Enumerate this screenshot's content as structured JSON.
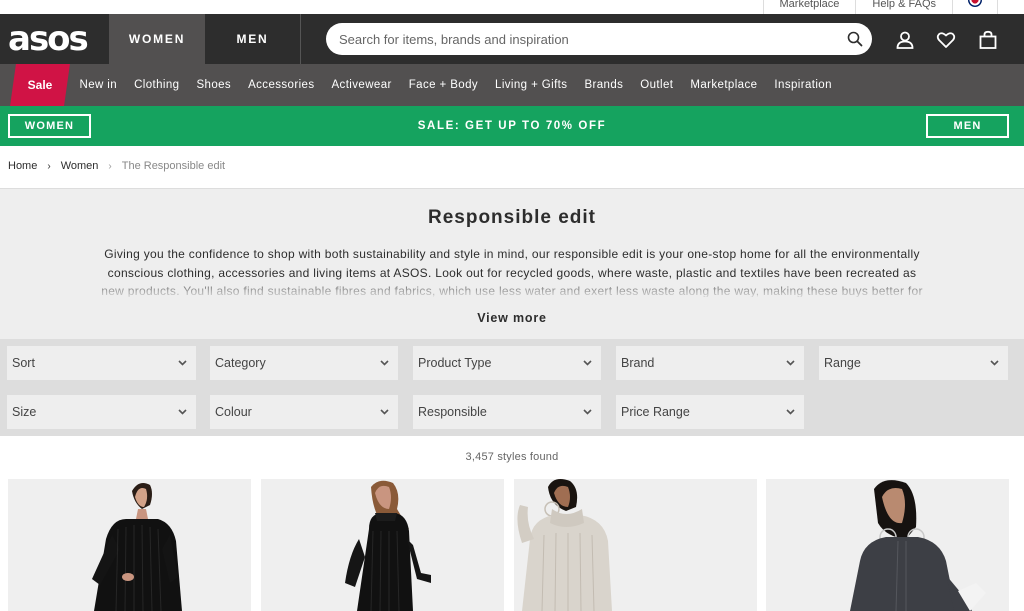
{
  "utility": {
    "links": [
      "Marketplace",
      "Help & FAQs"
    ],
    "flag": "uk-flag-icon"
  },
  "header": {
    "logo": "asos",
    "gender_tabs": [
      "WOMEN",
      "MEN"
    ],
    "search_placeholder": "Search for items, brands and inspiration",
    "icons": [
      "search-icon",
      "account-icon",
      "heart-icon",
      "bag-icon"
    ]
  },
  "catnav": {
    "sale": "Sale",
    "items": [
      "New in",
      "Clothing",
      "Shoes",
      "Accessories",
      "Activewear",
      "Face + Body",
      "Living + Gifts",
      "Brands",
      "Outlet",
      "Marketplace",
      "Inspiration"
    ]
  },
  "promo": {
    "left_button": "WOMEN",
    "text": "SALE: GET UP TO 70% OFF",
    "right_button": "MEN"
  },
  "breadcrumb": {
    "items": [
      "Home",
      "Women",
      "The Responsible edit"
    ]
  },
  "intro": {
    "title": "Responsible edit",
    "description": "Giving you the confidence to shop with both sustainability and style in mind, our responsible edit is your one-stop home for all the environmentally conscious clothing, accessories and living items at ASOS. Look out for recycled goods, where waste, plastic and textiles have been recreated as new products. You'll also find sustainable fibres and fabrics, which use less water and exert less waste along the way, making these buys better for the",
    "view_more": "View more"
  },
  "filters": {
    "row1": [
      "Sort",
      "Category",
      "Product Type",
      "Brand",
      "Range"
    ],
    "row2": [
      "Size",
      "Colour",
      "Responsible",
      "Price Range"
    ]
  },
  "results": {
    "count_text": "3,457 styles found"
  },
  "colors": {
    "header_bg": "#2d2d2d",
    "nav_bg": "#525050",
    "sale_red": "#d01345",
    "promo_green": "#15a35f"
  }
}
